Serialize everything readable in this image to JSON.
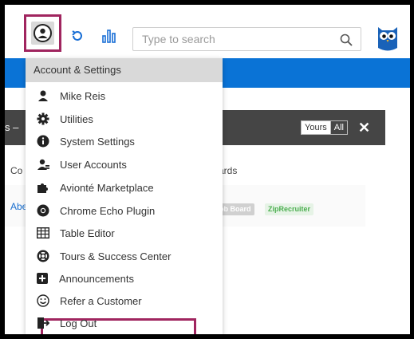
{
  "search": {
    "placeholder": "Type to search"
  },
  "panel": {
    "title": "s –",
    "toggle_yours": "Yours",
    "toggle_all": "All",
    "close": "✕",
    "col_left": "Co",
    "col_right": "ards",
    "row_link": "Abe",
    "badge_job_board": "ob Board",
    "badge_ziprecruiter": "ZipRecruiter"
  },
  "menu": {
    "header": "Account & Settings",
    "items": [
      {
        "label": "Mike Reis",
        "icon": "user-icon"
      },
      {
        "label": "Utilities",
        "icon": "gear-icon"
      },
      {
        "label": "System Settings",
        "icon": "info-icon"
      },
      {
        "label": "User Accounts",
        "icon": "users-icon"
      },
      {
        "label": "Avionté Marketplace",
        "icon": "puzzle-icon"
      },
      {
        "label": "Chrome Echo Plugin",
        "icon": "chrome-icon"
      },
      {
        "label": "Table Editor",
        "icon": "table-icon"
      },
      {
        "label": "Tours & Success Center",
        "icon": "lifebuoy-icon"
      },
      {
        "label": "Announcements",
        "icon": "plus-square-icon"
      },
      {
        "label": "Refer a Customer",
        "icon": "smile-icon"
      },
      {
        "label": "Log Out",
        "icon": "logout-icon"
      }
    ]
  },
  "colors": {
    "accent": "#a0255f",
    "brand_blue": "#0a73d6",
    "panel_header": "#454545"
  }
}
